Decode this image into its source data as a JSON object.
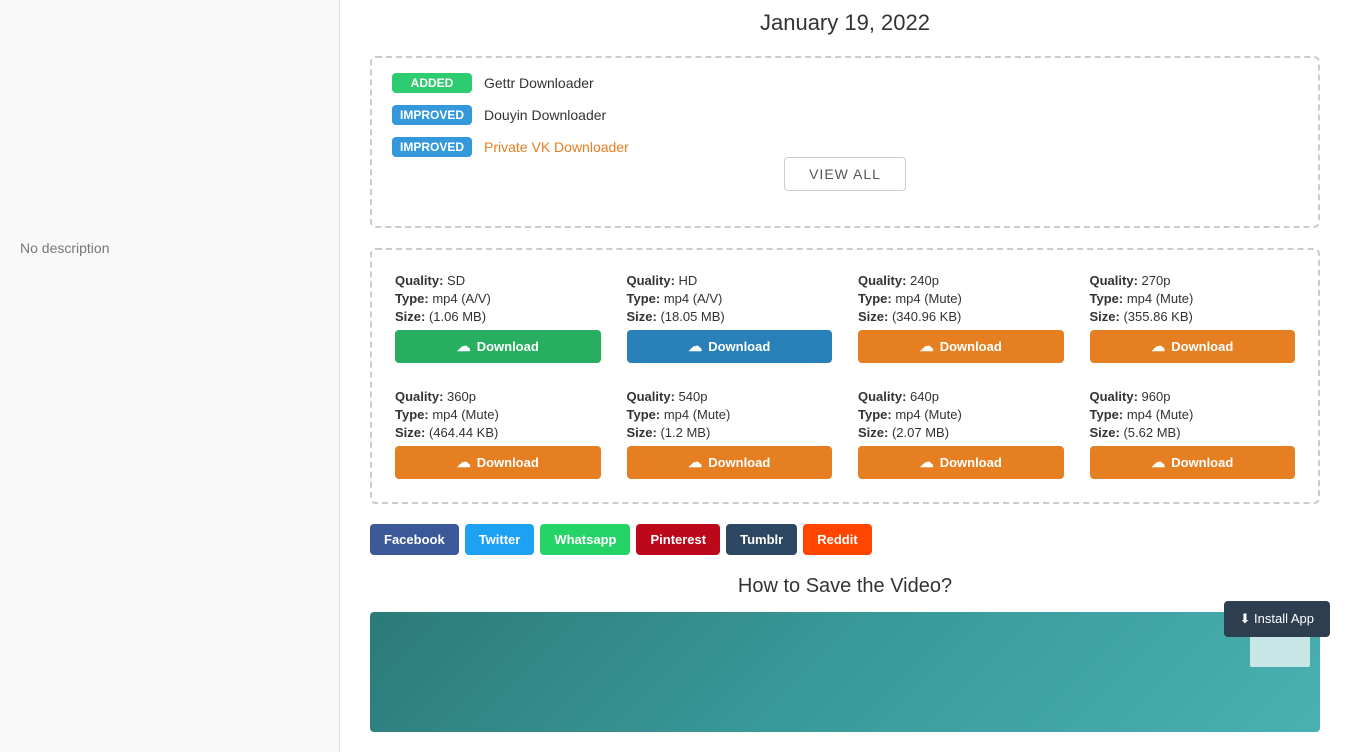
{
  "date": "January 19, 2022",
  "updates": {
    "items": [
      {
        "badge": "ADDED",
        "badge_type": "added",
        "label": "Gettr Downloader",
        "is_link": false
      },
      {
        "badge": "IMPROVED",
        "badge_type": "improved",
        "label": "Douyin Downloader",
        "is_link": false
      },
      {
        "badge": "IMPROVED",
        "badge_type": "improved",
        "label": "Private VK Downloader",
        "is_link": true
      }
    ],
    "view_all_label": "VIEW ALL"
  },
  "download_cards": [
    {
      "row": 0,
      "quality_label": "Quality:",
      "quality": "SD",
      "type_label": "Type:",
      "type": "mp4 (A/V)",
      "size_label": "Size:",
      "size": "(1.06 MB)",
      "btn_color": "green",
      "btn_label": "Download"
    },
    {
      "row": 0,
      "quality_label": "Quality:",
      "quality": "HD",
      "type_label": "Type:",
      "type": "mp4 (A/V)",
      "size_label": "Size:",
      "size": "(18.05 MB)",
      "btn_color": "blue",
      "btn_label": "Download"
    },
    {
      "row": 0,
      "quality_label": "Quality:",
      "quality": "240p",
      "type_label": "Type:",
      "type": "mp4 (Mute)",
      "size_label": "Size:",
      "size": "(340.96 KB)",
      "btn_color": "orange",
      "btn_label": "Download"
    },
    {
      "row": 0,
      "quality_label": "Quality:",
      "quality": "270p",
      "type_label": "Type:",
      "type": "mp4 (Mute)",
      "size_label": "Size:",
      "size": "(355.86 KB)",
      "btn_color": "orange",
      "btn_label": "Download"
    },
    {
      "row": 1,
      "quality_label": "Quality:",
      "quality": "360p",
      "type_label": "Type:",
      "type": "mp4 (Mute)",
      "size_label": "Size:",
      "size": "(464.44 KB)",
      "btn_color": "orange",
      "btn_label": "Download"
    },
    {
      "row": 1,
      "quality_label": "Quality:",
      "quality": "540p",
      "type_label": "Type:",
      "type": "mp4 (Mute)",
      "size_label": "Size:",
      "size": "(1.2 MB)",
      "btn_color": "orange",
      "btn_label": "Download"
    },
    {
      "row": 1,
      "quality_label": "Quality:",
      "quality": "640p",
      "type_label": "Type:",
      "type": "mp4 (Mute)",
      "size_label": "Size:",
      "size": "(2.07 MB)",
      "btn_color": "orange",
      "btn_label": "Download"
    },
    {
      "row": 1,
      "quality_label": "Quality:",
      "quality": "960p",
      "type_label": "Type:",
      "type": "mp4 (Mute)",
      "size_label": "Size:",
      "size": "(5.62 MB)",
      "btn_color": "orange",
      "btn_label": "Download"
    }
  ],
  "social_buttons": [
    {
      "label": "Facebook",
      "class": "btn-facebook"
    },
    {
      "label": "Twitter",
      "class": "btn-twitter"
    },
    {
      "label": "Whatsapp",
      "class": "btn-whatsapp"
    },
    {
      "label": "Pinterest",
      "class": "btn-pinterest"
    },
    {
      "label": "Tumblr",
      "class": "btn-tumblr"
    },
    {
      "label": "Reddit",
      "class": "btn-reddit"
    }
  ],
  "how_to_heading": "How to Save the Video?",
  "no_description": "No description",
  "install_app_label": "⬇ Install App"
}
